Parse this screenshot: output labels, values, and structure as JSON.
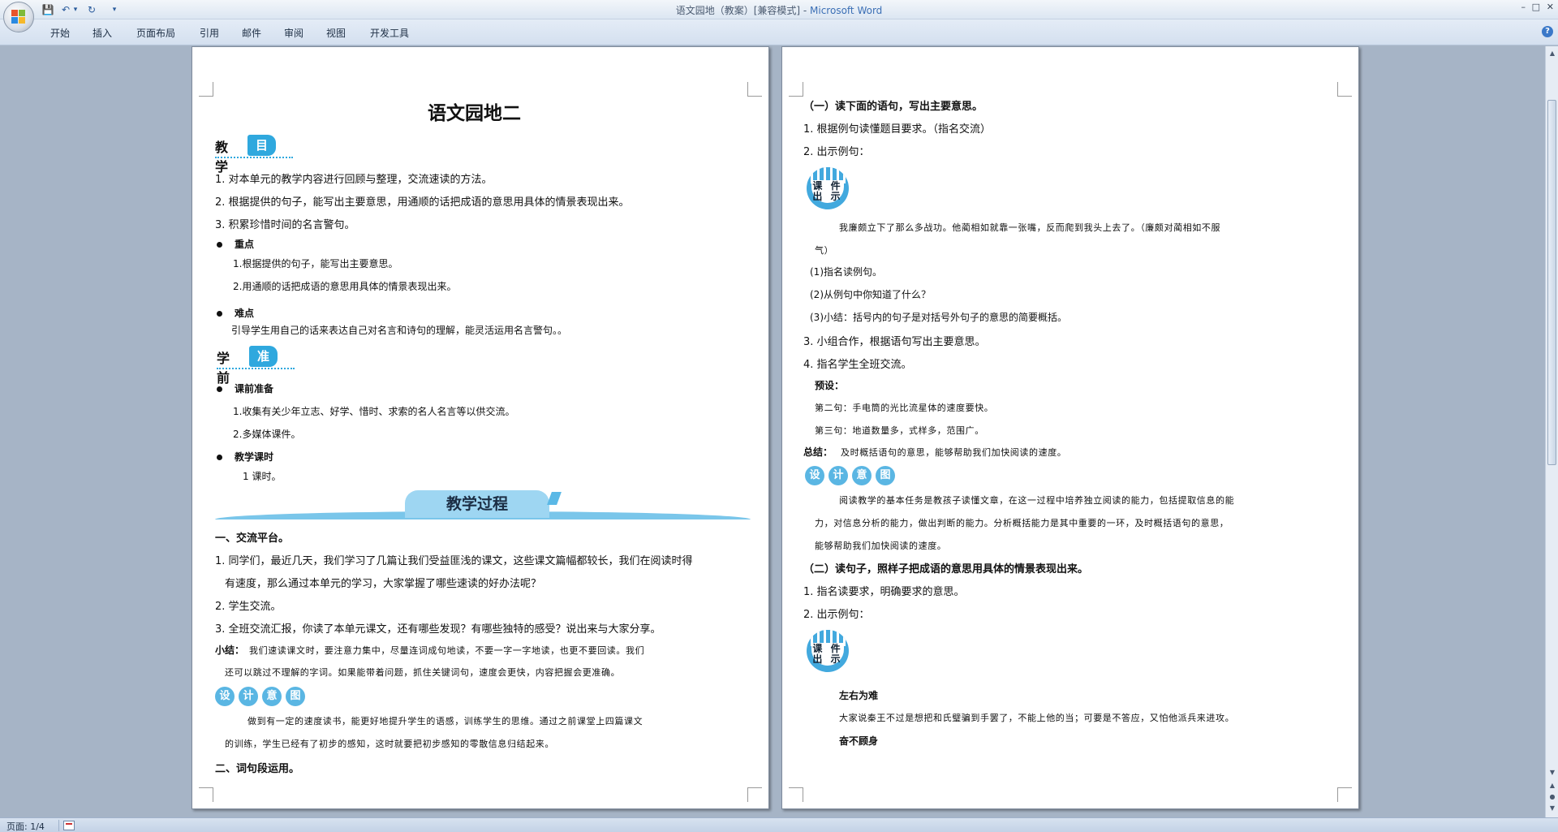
{
  "window": {
    "title_doc": "语文园地（教案）[兼容模式] - ",
    "title_app": "Microsoft Word",
    "min": "–",
    "restore": "□",
    "close": "✕"
  },
  "qat": {
    "save": "💾",
    "undo": "↶",
    "undo_drop": "▾",
    "redo": "↻",
    "custom": "▾"
  },
  "tabs": [
    "开始",
    "插入",
    "页面布局",
    "引用",
    "邮件",
    "审阅",
    "视图",
    "开发工具"
  ],
  "help": "?",
  "page1": {
    "title": "语文园地二",
    "goal_head": {
      "lead": "教学",
      "tag": "目标"
    },
    "goals": [
      "1. 对本单元的教学内容进行回顾与整理，交流速读的方法。",
      "2. 根据提供的句子，能写出主要意思，用通顺的话把成语的意思用具体的情景表现出来。",
      "3. 积累珍惜时间的名言警句。"
    ],
    "key_label": "重点",
    "key_items": [
      "1.根据提供的句子，能写出主要意思。",
      "2.用通顺的话把成语的意思用具体的情景表现出来。"
    ],
    "diff_label": "难点",
    "diff_text": "引导学生用自己的话来表达自己对名言和诗句的理解，能灵活运用名言警句。。",
    "prep_head": {
      "lead": "学前",
      "tag": "准备"
    },
    "prep_label": "课前准备",
    "prep_items": [
      "1.收集有关少年立志、好学、惜时、求索的名人名言等以供交流。",
      "2.多媒体课件。"
    ],
    "time_label": "教学课时",
    "time_text": "1 课时。",
    "process_banner": "教学过程",
    "s1_title": "一、交流平台。",
    "s1_items": [
      "1. 同学们，最近几天，我们学习了几篇让我们受益匪浅的课文，这些课文篇幅都较长，我们在阅读时得",
      "有速度，那么通过本单元的学习，大家掌握了哪些速读的好办法呢？",
      "2. 学生交流。",
      "3. 全班交流汇报，你读了本单元课文，还有哪些发现？有哪些独特的感受？说出来与大家分享。"
    ],
    "summary_label": "小结：",
    "summary_line1": "我们速读课文时，要注意力集中，尽量连词成句地读，不要一字一字地读，也更不要回读。我们",
    "summary_line2": "还可以跳过不理解的字词。如果能带着问题，抓住关键词句，速度会更快，内容把握会更准确。",
    "yitu": [
      "设",
      "计",
      "意",
      "图"
    ],
    "design_line1": "做到有一定的速度读书，能更好地提升学生的语感，训练学生的思维。通过之前课堂上四篇课文",
    "design_line2": "的训练，学生已经有了初步的感知，这时就要把初步感知的零散信息归结起来。",
    "s2_title": "二、词句段运用。",
    "mark": "↵"
  },
  "page2": {
    "p1_title": "（一）读下面的语句，写出主要意思。",
    "items_a": [
      "1. 根据例句读懂题目要求。（指名交流）",
      "2. 出示例句："
    ],
    "kejian": "课 件 出 示",
    "example_line1": "我廉颇立下了那么多战功。他蔺相如就靠一张嘴，反而爬到我头上去了。（廉颇对蔺相如不服",
    "example_line2": "气）",
    "sub_items": [
      "(1)指名读例句。",
      "(2)从例句中你知道了什么？",
      "(3)小结：括号内的句子是对括号外句子的意思的简要概括。"
    ],
    "items_b": [
      "3. 小组合作，根据语句写出主要意思。",
      "4. 指名学生全班交流。"
    ],
    "preset_label": "预设：",
    "presets": [
      "第二句：手电筒的光比流星体的速度要快。",
      "第三句：地道数量多，式样多，范围广。"
    ],
    "total_label": "总结：",
    "total_text": "及时概括语句的意思，能够帮助我们加快阅读的速度。",
    "yitu": [
      "设",
      "计",
      "意",
      "图"
    ],
    "design_lines": [
      "阅读教学的基本任务是教孩子读懂文章，在这一过程中培养独立阅读的能力，包括提取信息的能",
      "力，对信息分析的能力，做出判断的能力。分析概括能力是其中重要的一环，及时概括语句的意思，",
      "能够帮助我们加快阅读的速度。"
    ],
    "p2_title": "（二）读句子，照样子把成语的意思用具体的情景表现出来。",
    "items_c": [
      "1. 指名读要求，明确要求的意思。",
      "2. 出示例句："
    ],
    "idiom1": "左右为难",
    "idiom1_text": "大家说秦王不过是想把和氏璧骗到手罢了，不能上他的当；可要是不答应，又怕他派兵来进攻。",
    "idiom2": "奋不顾身",
    "mark": "↵"
  },
  "status": {
    "page": "页面: 1/4"
  },
  "colors": {
    "accent": "#2fa8de",
    "ribbon": "#dce6f2",
    "workspace": "#a6b4c6"
  }
}
